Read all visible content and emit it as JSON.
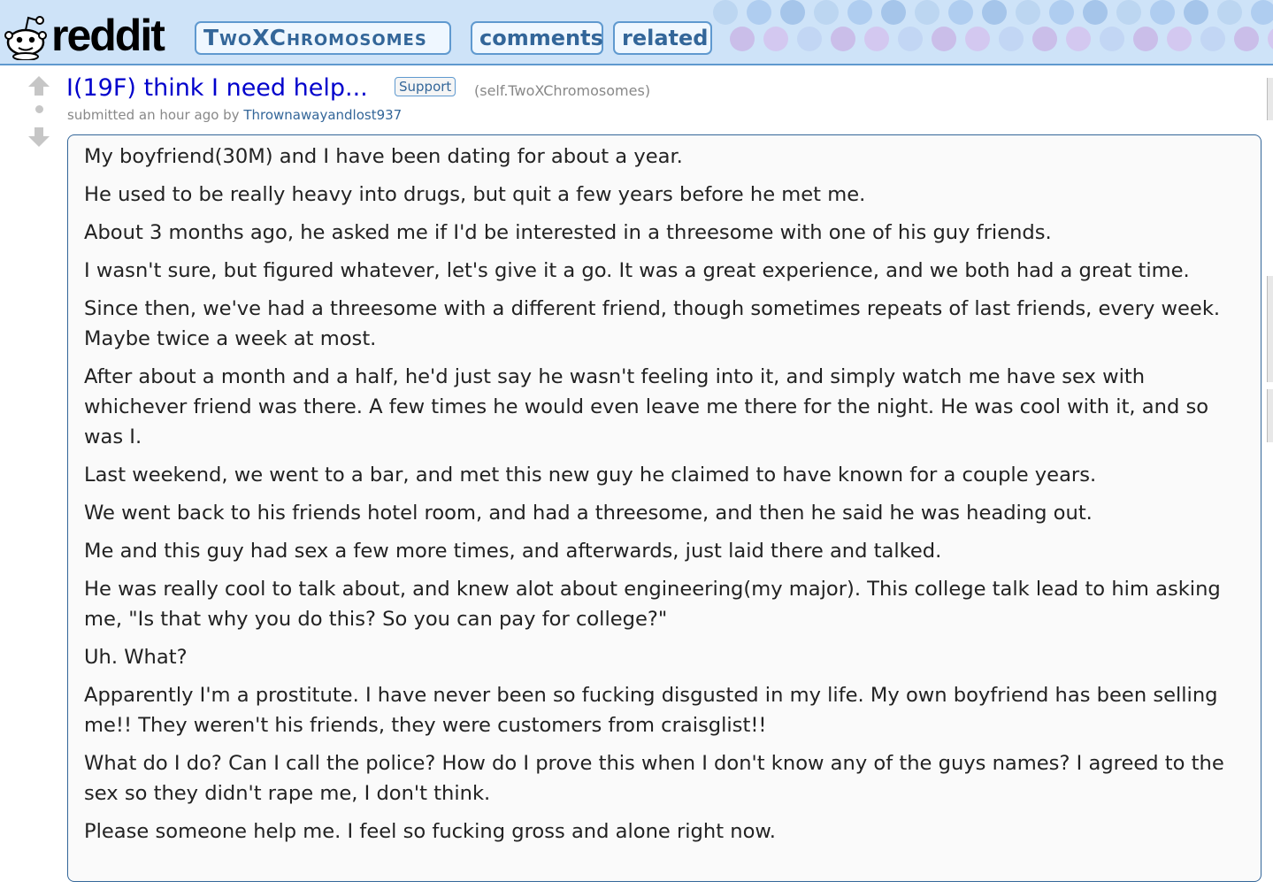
{
  "header": {
    "logo_text": "reddit",
    "subreddit_tab": "TwoXChromosomes",
    "comments_tab": "comments",
    "related_tab": "related",
    "colors": {
      "header_bg": "#cee3f8",
      "border": "#5f99cf",
      "tab_text": "#336699"
    }
  },
  "post": {
    "title": "I(19F) think I need help...",
    "flair": "Support",
    "domain": "(self.TwoXChromosomes)",
    "tagline_prefix": "submitted an hour ago by",
    "author": "Thrownawayandlost937",
    "icons": {
      "upvote": "upvote-arrow-icon",
      "downvote": "downvote-arrow-icon"
    },
    "selftext": [
      "My boyfriend(30M) and I have been dating for about a year.",
      "He used to be really heavy into drugs, but quit a few years before he met me.",
      "About 3 months ago, he asked me if I'd be interested in a threesome with one of his guy friends.",
      "I wasn't sure, but figured whatever, let's give it a go. It was a great experience, and we both had a great time.",
      "Since then, we've had a threesome with a different friend, though sometimes repeats of last friends, every week. Maybe twice a week at most.",
      "After about a month and a half, he'd just say he wasn't feeling into it, and simply watch me have sex with whichever friend was there. A few times he would even leave me there for the night. He was cool with it, and so was I.",
      "Last weekend, we went to a bar, and met this new guy he claimed to have known for a couple years.",
      "We went back to his friends hotel room, and had a threesome, and then he said he was heading out.",
      "Me and this guy had sex a few more times, and afterwards, just laid there and talked.",
      "He was really cool to talk about, and knew alot about engineering(my major). This college talk lead to him asking me, \"Is that why you do this? So you can pay for college?\"",
      "Uh. What?",
      "Apparently I'm a prostitute. I have never been so fucking disgusted in my life. My own boyfriend has been selling me!! They weren't his friends, they were customers from craisglist!!",
      "What do I do? Can I call the police? How do I prove this when I don't know any of the guys names? I agreed to the sex so they didn't rape me, I don't think.",
      "Please someone help me. I feel so fucking gross and alone right now."
    ]
  }
}
